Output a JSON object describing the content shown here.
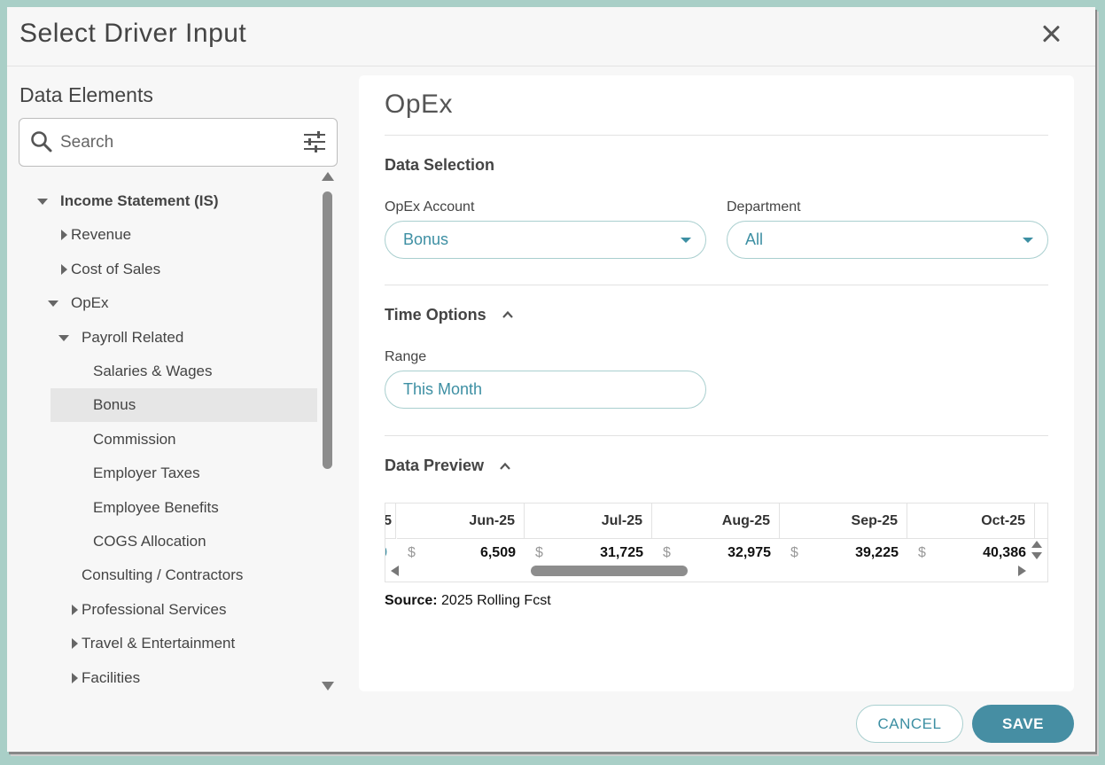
{
  "dialog": {
    "title": "Select Driver Input",
    "close_icon": "close-icon"
  },
  "left": {
    "title": "Data Elements",
    "search_placeholder": "Search",
    "tree": [
      {
        "label": "Income Statement (IS)",
        "level": 0,
        "caret": "down",
        "bold": true
      },
      {
        "label": "Revenue",
        "level": 1,
        "caret": "right"
      },
      {
        "label": "Cost of Sales",
        "level": 1,
        "caret": "right"
      },
      {
        "label": "OpEx",
        "level": 1,
        "caret": "down"
      },
      {
        "label": "Payroll Related",
        "level": 2,
        "caret": "down"
      },
      {
        "label": "Salaries & Wages",
        "level": 3,
        "caret": "none"
      },
      {
        "label": "Bonus",
        "level": 3,
        "caret": "none",
        "selected": true
      },
      {
        "label": "Commission",
        "level": 3,
        "caret": "none"
      },
      {
        "label": "Employer Taxes",
        "level": 3,
        "caret": "none"
      },
      {
        "label": "Employee Benefits",
        "level": 3,
        "caret": "none"
      },
      {
        "label": "COGS Allocation",
        "level": 3,
        "caret": "none"
      },
      {
        "label": "Consulting / Contractors",
        "level": 2,
        "caret": "none"
      },
      {
        "label": "Professional Services",
        "level": 2,
        "caret": "right"
      },
      {
        "label": "Travel & Entertainment",
        "level": 2,
        "caret": "right"
      },
      {
        "label": "Facilities",
        "level": 2,
        "caret": "right"
      }
    ]
  },
  "right": {
    "title": "OpEx",
    "data_selection": {
      "title": "Data Selection",
      "account_label": "OpEx Account",
      "account_value": "Bonus",
      "department_label": "Department",
      "department_value": "All"
    },
    "time_options": {
      "title": "Time Options",
      "range_label": "Range",
      "range_value": "This Month"
    },
    "data_preview": {
      "title": "Data Preview",
      "partial_header": "5",
      "partial_value": "0",
      "columns": [
        {
          "month": "Jun-25",
          "currency": "$",
          "value": "6,509"
        },
        {
          "month": "Jul-25",
          "currency": "$",
          "value": "31,725"
        },
        {
          "month": "Aug-25",
          "currency": "$",
          "value": "32,975"
        },
        {
          "month": "Sep-25",
          "currency": "$",
          "value": "39,225"
        },
        {
          "month": "Oct-25",
          "currency": "$",
          "value": "40,386"
        }
      ],
      "source_label": "Source:",
      "source_value": "2025 Rolling Fcst"
    }
  },
  "footer": {
    "cancel_label": "CANCEL",
    "save_label": "SAVE"
  },
  "colors": {
    "accent": "#3d8fa3",
    "save_bg": "#468ea3",
    "selected_row": "#e6e6e6",
    "backdrop": "#a9cfc7"
  }
}
